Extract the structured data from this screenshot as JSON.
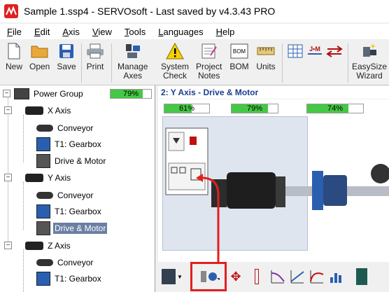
{
  "window": {
    "title": "Sample 1.ssp4 - SERVOsoft - Last saved by v4.3.43 PRO"
  },
  "menu": [
    {
      "u": "F",
      "rest": "ile"
    },
    {
      "u": "E",
      "rest": "dit"
    },
    {
      "u": "A",
      "rest": "xis"
    },
    {
      "u": "V",
      "rest": "iew"
    },
    {
      "u": "T",
      "rest": "ools"
    },
    {
      "u": "L",
      "rest": "anguages"
    },
    {
      "u": "H",
      "rest": "elp"
    }
  ],
  "toolbar": {
    "new": "New",
    "open": "Open",
    "save": "Save",
    "print": "Print",
    "manage_axes_1": "Manage",
    "manage_axes_2": "Axes",
    "system_check_1": "System",
    "system_check_2": "Check",
    "project_notes_1": "Project",
    "project_notes_2": "Notes",
    "bom": "BOM",
    "bom_icon": "BOM",
    "units": "Units",
    "jm_icon": "J•M",
    "easysize_1": "EasySize",
    "easysize_2": "Wizard"
  },
  "tree": {
    "power_group": "Power Group",
    "power_group_pct": "79%",
    "x_axis": "X Axis",
    "conveyor": "Conveyor",
    "gearbox": "T1: Gearbox",
    "drive_motor": "Drive & Motor",
    "y_axis": "Y Axis",
    "y_conveyor": "Conveyor",
    "y_gearbox": "T1: Gearbox",
    "y_drive_motor": "Drive & Motor",
    "z_axis": "Z Axis",
    "z_conveyor": "Conveyor",
    "z_gearbox": "T1: Gearbox"
  },
  "progress": {
    "power_group": 0.79,
    "bar1": 0.61,
    "bar2": 0.79,
    "bar3": 0.74
  },
  "panel": {
    "heading": "2: Y Axis - Drive & Motor",
    "bar1": "61%",
    "bar2": "79%",
    "bar3": "74%"
  },
  "colors": {
    "accent": "#1a3d8f",
    "progress_fill": "#45c845",
    "highlight": "#e02020",
    "selection": "#6b7fa3"
  },
  "icons": [
    "new-icon",
    "open-folder-icon",
    "save-disk-icon",
    "printer-icon",
    "manage-axes-icon",
    "warning-icon",
    "notes-icon",
    "bom-icon",
    "ruler-units-icon",
    "grid-icon",
    "jm-icon",
    "arrows-icon",
    "wizard-icon"
  ]
}
